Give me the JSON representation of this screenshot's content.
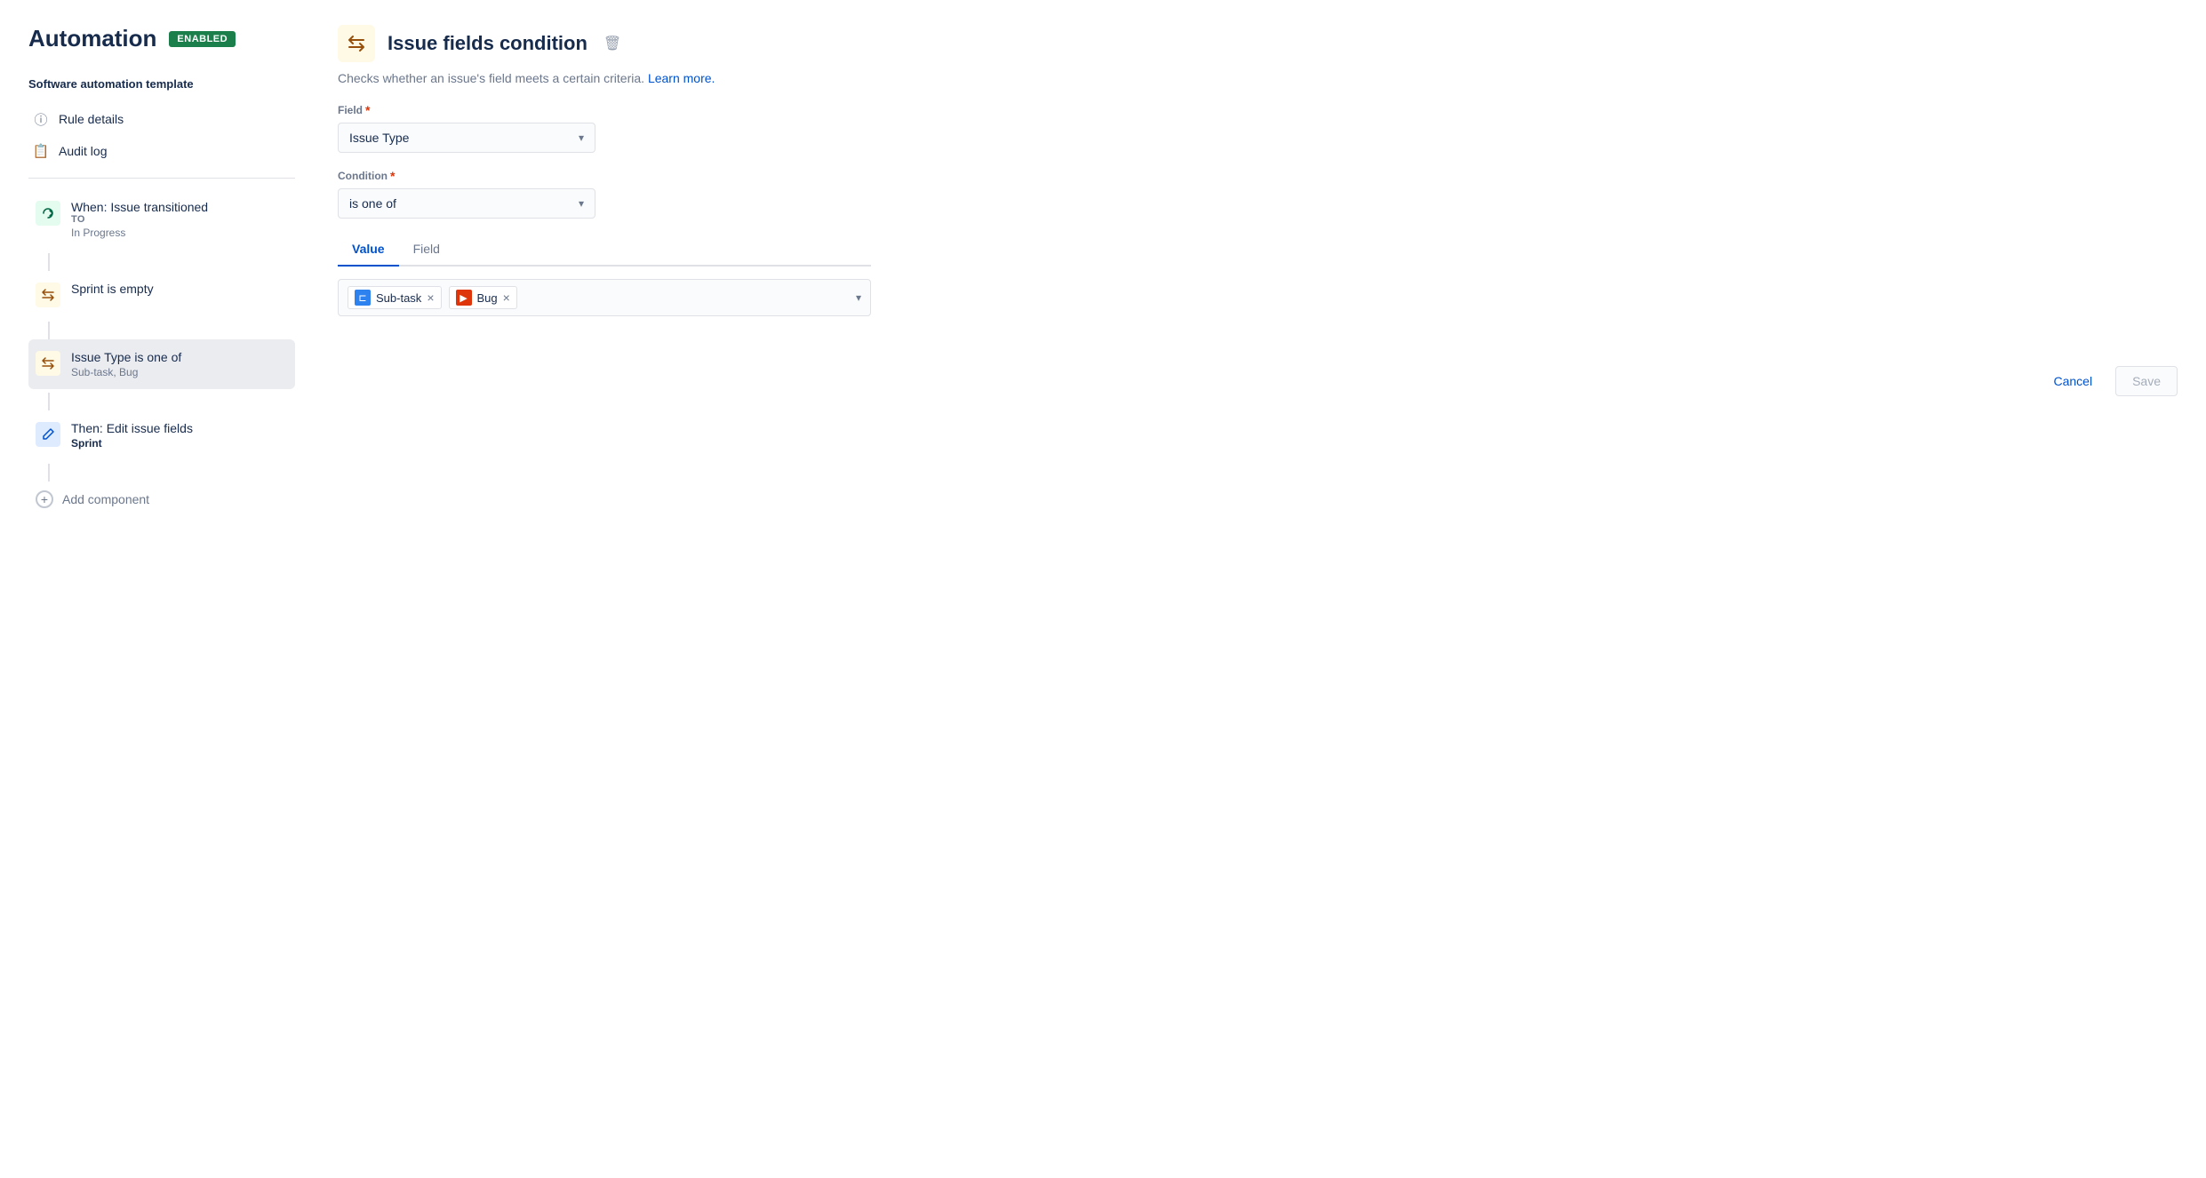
{
  "page": {
    "title": "Automation",
    "badge": "ENABLED"
  },
  "sidebar": {
    "template_label": "Software automation template",
    "nav_items": [
      {
        "id": "rule-details",
        "label": "Rule details",
        "icon": "ⓘ"
      },
      {
        "id": "audit-log",
        "label": "Audit log",
        "icon": "📋"
      }
    ],
    "steps": [
      {
        "id": "trigger",
        "type": "green",
        "icon": "↩",
        "title": "When: Issue transitioned",
        "label_line": "TO",
        "subtitle": "In Progress"
      },
      {
        "id": "condition-sprint",
        "type": "yellow",
        "icon": "⇄",
        "title": "Sprint is empty",
        "subtitle": ""
      },
      {
        "id": "condition-issue-type",
        "type": "yellow",
        "icon": "⇄",
        "title": "Issue Type is one of",
        "subtitle": "Sub-task, Bug",
        "active": true
      },
      {
        "id": "action",
        "type": "blue",
        "icon": "✏",
        "title": "Then: Edit issue fields",
        "subtitle": "Sprint",
        "subtitle_bold": true
      }
    ],
    "add_component_label": "Add component"
  },
  "panel": {
    "icon": "⇄",
    "title": "Issue fields condition",
    "description": "Checks whether an issue's field meets a certain criteria.",
    "learn_more_text": "Learn more.",
    "field_label": "Field",
    "field_value": "Issue Type",
    "condition_label": "Condition",
    "condition_value": "is one of",
    "tabs": [
      {
        "id": "value",
        "label": "Value",
        "active": true
      },
      {
        "id": "field",
        "label": "Field",
        "active": false
      }
    ],
    "tags": [
      {
        "id": "subtask",
        "label": "Sub-task",
        "icon_type": "blue",
        "icon_text": "⊏"
      },
      {
        "id": "bug",
        "label": "Bug",
        "icon_type": "red",
        "icon_text": "▶"
      }
    ],
    "cancel_label": "Cancel",
    "save_label": "Save"
  }
}
